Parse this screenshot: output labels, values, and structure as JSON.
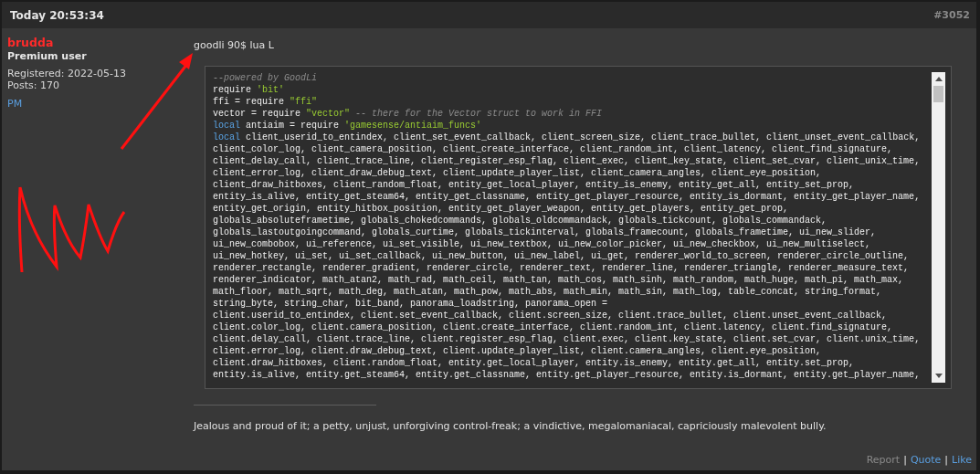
{
  "post": {
    "time": "Today 20:53:34",
    "number": "#3052"
  },
  "author": {
    "name": "brudda",
    "rank": "Premium user",
    "registered": "Registered: 2022-05-13",
    "posts": "Posts: 170",
    "pm": "PM"
  },
  "message": "goodli 90$ lua L",
  "code_lines": [
    [
      {
        "kind": "comment",
        "text": "--powered by GoodLi"
      }
    ],
    [
      {
        "kind": "plain",
        "text": "require "
      },
      {
        "kind": "string",
        "text": "'bit'"
      }
    ],
    [
      {
        "kind": "plain",
        "text": "ffi = require "
      },
      {
        "kind": "string",
        "text": "\"ffi\""
      }
    ],
    [
      {
        "kind": "plain",
        "text": "vector = require "
      },
      {
        "kind": "string",
        "text": "\"vector\""
      },
      {
        "kind": "comment",
        "text": " -- there for the Vector struct to work in FFI"
      }
    ],
    [
      {
        "kind": "keyword",
        "text": "local"
      },
      {
        "kind": "plain",
        "text": " antiaim = require "
      },
      {
        "kind": "string",
        "text": "'gamesense/antiaim_funcs'"
      }
    ],
    [
      {
        "kind": "keyword",
        "text": "local"
      },
      {
        "kind": "plain",
        "text": " client_userid_to_entindex, client_set_event_callback, client_screen_size, client_trace_bullet, client_unset_event_callback,"
      }
    ],
    [
      {
        "kind": "plain",
        "text": "client_color_log, client_camera_position, client_create_interface, client_random_int, client_latency, client_find_signature,"
      }
    ],
    [
      {
        "kind": "plain",
        "text": "client_delay_call, client_trace_line, client_register_esp_flag, client_exec, client_key_state, client_set_cvar, client_unix_time,"
      }
    ],
    [
      {
        "kind": "plain",
        "text": "client_error_log, client_draw_debug_text, client_update_player_list, client_camera_angles, client_eye_position,"
      }
    ],
    [
      {
        "kind": "plain",
        "text": "client_draw_hitboxes, client_random_float, entity_get_local_player, entity_is_enemy, entity_get_all, entity_set_prop,"
      }
    ],
    [
      {
        "kind": "plain",
        "text": "entity_is_alive, entity_get_steam64, entity_get_classname, entity_get_player_resource, entity_is_dormant, entity_get_player_name,"
      }
    ],
    [
      {
        "kind": "plain",
        "text": "entity_get_origin, entity_hitbox_position, entity_get_player_weapon, entity_get_players, entity_get_prop,"
      }
    ],
    [
      {
        "kind": "plain",
        "text": "globals_absoluteframetime, globals_chokedcommands, globals_oldcommandack, globals_tickcount, globals_commandack,"
      }
    ],
    [
      {
        "kind": "plain",
        "text": "globals_lastoutgoingcommand, globals_curtime, globals_tickinterval, globals_framecount, globals_frametime, ui_new_slider,"
      }
    ],
    [
      {
        "kind": "plain",
        "text": "ui_new_combobox, ui_reference, ui_set_visible, ui_new_textbox, ui_new_color_picker, ui_new_checkbox, ui_new_multiselect,"
      }
    ],
    [
      {
        "kind": "plain",
        "text": "ui_new_hotkey, ui_set, ui_set_callback, ui_new_button, ui_new_label, ui_get, renderer_world_to_screen, renderer_circle_outline,"
      }
    ],
    [
      {
        "kind": "plain",
        "text": "renderer_rectangle, renderer_gradient, renderer_circle, renderer_text, renderer_line, renderer_triangle, renderer_measure_text,"
      }
    ],
    [
      {
        "kind": "plain",
        "text": "renderer_indicator, math_atan2, math_rad, math_ceil, math_tan, math_cos, math_sinh, math_random, math_huge, math_pi, math_max,"
      }
    ],
    [
      {
        "kind": "plain",
        "text": "math_floor, math_sqrt, math_deg, math_atan, math_pow, math_abs, math_min, math_sin, math_log, table_concat, string_format,"
      }
    ],
    [
      {
        "kind": "plain",
        "text": "string_byte, string_char, bit_band, panorama_loadstring, panorama_open ="
      }
    ],
    [
      {
        "kind": "plain",
        "text": "client.userid_to_entindex, client.set_event_callback, client.screen_size, client.trace_bullet, client.unset_event_callback,"
      }
    ],
    [
      {
        "kind": "plain",
        "text": "client.color_log, client.camera_position, client.create_interface, client.random_int, client.latency, client.find_signature,"
      }
    ],
    [
      {
        "kind": "plain",
        "text": "client.delay_call, client.trace_line, client.register_esp_flag, client.exec, client.key_state, client.set_cvar, client.unix_time,"
      }
    ],
    [
      {
        "kind": "plain",
        "text": "client.error_log, client.draw_debug_text, client.update_player_list, client.camera_angles, client.eye_position,"
      }
    ],
    [
      {
        "kind": "plain",
        "text": "client.draw_hitboxes, client.random_float, entity.get_local_player, entity.is_enemy, entity.get_all, entity.set_prop,"
      }
    ],
    [
      {
        "kind": "plain",
        "text": "entity.is_alive, entity.get_steam64, entity.get_classname, entity.get_player_resource, entity.is_dormant, entity.get_player_name,"
      }
    ]
  ],
  "signature": "Jealous and proud of it; a petty, unjust, unforgiving control-freak; a vindictive, megalomaniacal, capriciously malevolent bully.",
  "actions": [
    {
      "kind": "muted",
      "label": "Report"
    },
    {
      "kind": "separator",
      "label": "|"
    },
    {
      "kind": "link",
      "label": "Quote"
    },
    {
      "kind": "separator",
      "label": "|"
    },
    {
      "kind": "link",
      "label": "Like"
    }
  ]
}
